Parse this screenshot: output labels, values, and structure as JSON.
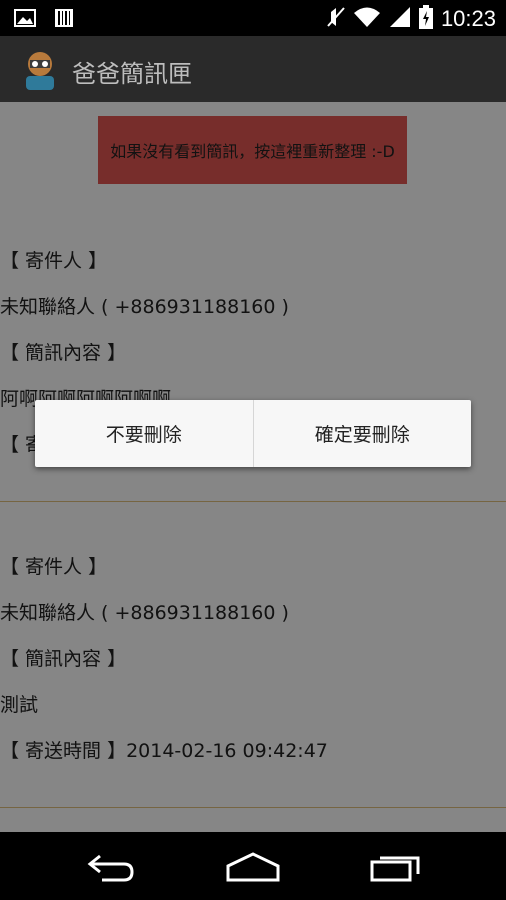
{
  "status_bar": {
    "time": "10:23",
    "icons": [
      "picture-icon",
      "barcode-icon",
      "muted-icon",
      "wifi-icon",
      "signal-icon",
      "battery-charging-icon"
    ]
  },
  "action_bar": {
    "title": "爸爸簡訊匣",
    "icon": "app-avatar-icon"
  },
  "refresh_button": {
    "label": "如果沒有看到簡訊，按這裡重新整理 :-D"
  },
  "messages": [
    {
      "sender_label": "【 寄件人 】",
      "sender_value": "未知聯絡人 ( +886931188160 )",
      "content_label": "【 簡訊內容 】",
      "content_value": "阿啊阿啊阿啊阿啊啊",
      "time_label": "【 寄"
    },
    {
      "sender_label": "【 寄件人 】",
      "sender_value": "未知聯絡人 ( +886931188160 )",
      "content_label": "【 簡訊內容 】",
      "content_value": "測試",
      "time_line": "【 寄送時間 】2014-02-16 09:42:47"
    }
  ],
  "dialog": {
    "cancel_label": "不要刪除",
    "confirm_label": "確定要刪除"
  },
  "nav_bar": {
    "icons": [
      "back-icon",
      "home-icon",
      "recent-apps-icon"
    ]
  },
  "colors": {
    "refresh_button_bg": "#d9534f",
    "divider": "#d8b878",
    "action_bar_bg": "#2a2a2a"
  }
}
